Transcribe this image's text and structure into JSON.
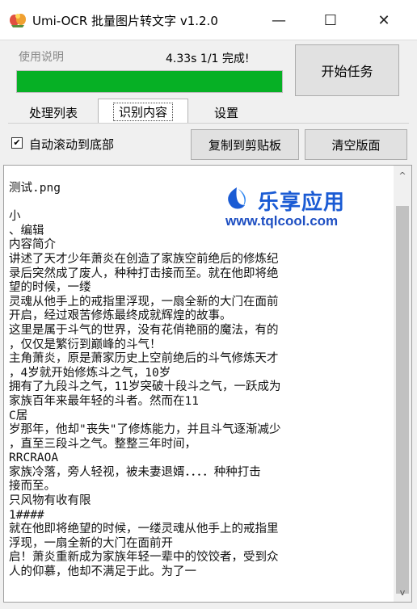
{
  "window": {
    "title": "Umi-OCR 批量图片转文字 v1.2.0",
    "controls": {
      "minimize": "—",
      "maximize": "☐",
      "close": "✕"
    }
  },
  "top": {
    "help_link": "使用说明",
    "status": "4.33s   1/1   完成!",
    "progress": 1.0,
    "start_button": "开始任务"
  },
  "tabs": [
    {
      "label": "处理列表",
      "active": false
    },
    {
      "label": "识别内容",
      "active": true
    },
    {
      "label": "设置",
      "active": false
    }
  ],
  "options": {
    "auto_scroll_label": "自动滚动到底部",
    "auto_scroll_checked": true,
    "check_mark": "✔",
    "copy_button": "复制到剪贴板",
    "clear_button": "清空版面"
  },
  "output_text": "测试.png\n\n小\n、编辑\n内容简介\n讲述了天才少年萧炎在创造了家族空前绝后的修炼纪\n录后突然成了废人，种种打击接而至。就在他即将绝\n望的时候，一缕\n灵魂从他手上的戒指里浮现，一扇全新的大门在面前\n开启，经过艰苦修炼最终成就辉煌的故事。\n这里是属于斗气的世界，没有花俏艳丽的魔法，有的\n，仅仅是繁衍到巅峰的斗气！\n主角萧炎，原是萧家历史上空前绝后的斗气修炼天才\n，4岁就开始修炼斗之气，10岁\n拥有了九段斗之气，11岁突破十段斗之气，一跃成为\n家族百年来最年轻的斗者。然而在11\nC居\n岁那年，他却\"丧失\"了修炼能力，并且斗气逐渐减少\n，直至三段斗之气。整整三年时间，\nRRCRAOA\n家族冷落，旁人轻视，被未妻退婿．．．．种种打击\n接而至。\n只风物有收有限\n1####\n就在他即将绝望的时候，一缕灵魂从他手上的戒指里\n浮现，一扇全新的大门在面前开\n启！萧炎重新成为家族年轻一辈中的饺饺者，受到众\n人的仰慕，他却不满足于此。为了一",
  "scrollbar": {
    "up_arrow": "^",
    "down_arrow": "v"
  },
  "watermark": {
    "name": "乐享应用",
    "url": "www.tqlcool.com",
    "colors": {
      "primary": "#1a5bd4",
      "secondary": "#1e4fc2"
    }
  },
  "colors": {
    "progress_fill": "#06b025",
    "window_bg": "#f0f0f0",
    "button_bg": "#e1e1e1"
  }
}
